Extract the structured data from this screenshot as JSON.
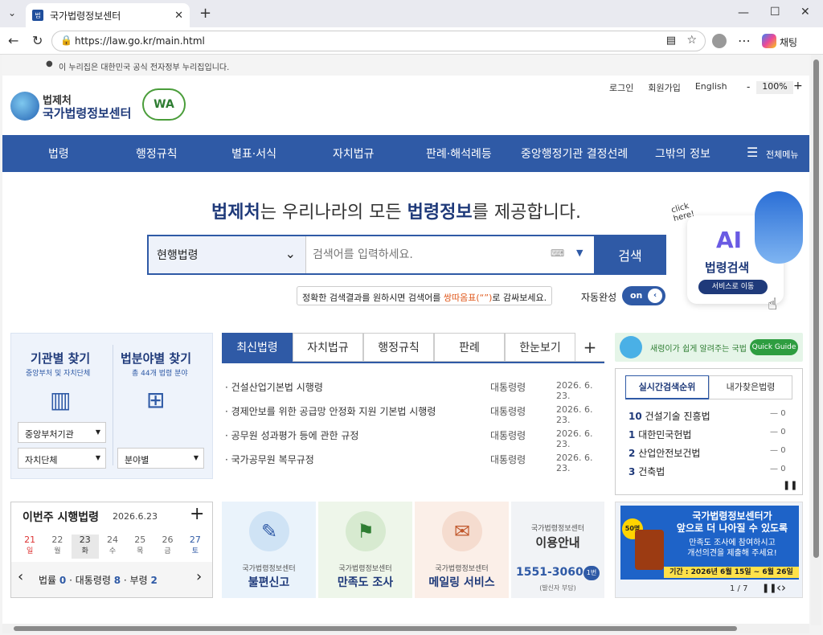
{
  "browser": {
    "tab_title": "국가법령정보센터",
    "url": "https://law.go.kr/main.html",
    "copilot": "채팅",
    "favicon_text": "법"
  },
  "gov_notice": "이 누리집은 대한민국 공식 전자정부 누리집입니다.",
  "header": {
    "org": "법제처",
    "site": "국가법령정보센터",
    "wa": "WA",
    "links": [
      "로그인",
      "회원가입",
      "English"
    ],
    "zoom": "100%",
    "zoom_minus": "-",
    "zoom_plus": "+"
  },
  "gnb": {
    "items": [
      "법령",
      "행정규칙",
      "별표·서식",
      "자치법규",
      "판례·해석례등",
      "중앙행정기관 결정선례",
      "그밖의 정보"
    ],
    "all_menu": "전체메뉴"
  },
  "search": {
    "headline_a": "법제처",
    "headline_b": "는 우리나라의 모든 ",
    "headline_c": "법령정보",
    "headline_d": "를 제공합니다.",
    "scope": "현행법령",
    "placeholder": "검색어를 입력하세요.",
    "button": "검색",
    "tip_a": "정확한 검색결과를 원하시면 검색어를 ",
    "tip_b": "쌍따옴표(“”)",
    "tip_c": "로 감싸보세요.",
    "autocomplete_label": "자동완성",
    "autocomplete_state": "on"
  },
  "ai": {
    "click": "click here!",
    "title_a": "AI",
    "title_b": "법령검색",
    "btn": "서비스로 이동"
  },
  "left_box": {
    "org_title": "기관별 찾기",
    "org_sub": "중앙부처 및 자치단체",
    "field_title": "법분야별 찾기",
    "field_sub": "총 44개 법령 분야",
    "sel1": "중앙부처기관",
    "sel2": "자치단체",
    "sel3": "분야별"
  },
  "news": {
    "tabs": [
      "최신법령",
      "자치법규",
      "행정규칙",
      "판례",
      "한눈보기",
      "+"
    ],
    "rows": [
      {
        "t": "건설산업기본법 시행령",
        "k": "대통령령",
        "d": "2026. 6. 23."
      },
      {
        "t": "경제안보를 위한 공급망 안정화 지원 기본법 시행령",
        "k": "대통령령",
        "d": "2026. 6. 23."
      },
      {
        "t": "공무원 성과평가 등에 관한 규정",
        "k": "대통령령",
        "d": "2026. 6. 23."
      },
      {
        "t": "국가공무원 복무규정",
        "k": "대통령령",
        "d": "2026. 6. 23."
      }
    ]
  },
  "banner_guide": {
    "text": "새령이가 쉽게 알려주는 국법",
    "btn": "Quick Guide"
  },
  "ranking": {
    "tabs": [
      "실시간검색순위",
      "내가찾은법령"
    ],
    "items": [
      {
        "n": "10",
        "t": "건설기술 진흥법",
        "c": "0"
      },
      {
        "n": "1",
        "t": "대한민국헌법",
        "c": "0"
      },
      {
        "n": "2",
        "t": "산업안전보건법",
        "c": "0"
      },
      {
        "n": "3",
        "t": "건축법",
        "c": "0"
      }
    ],
    "pause": "❚❚"
  },
  "week": {
    "title": "이번주 시행법령",
    "date": "2026.6.23",
    "plus": "+",
    "days": [
      {
        "n": "21",
        "w": "일"
      },
      {
        "n": "22",
        "w": "월"
      },
      {
        "n": "23",
        "w": "화"
      },
      {
        "n": "24",
        "w": "수"
      },
      {
        "n": "25",
        "w": "목"
      },
      {
        "n": "26",
        "w": "금"
      },
      {
        "n": "27",
        "w": "토"
      }
    ],
    "law_label": "법률",
    "law_n": "0",
    "pres_label": "대통령령",
    "pres_n": "8",
    "min_label": "부령",
    "min_n": "2"
  },
  "services": [
    {
      "sub": "국가법령정보센터",
      "title": "불편신고"
    },
    {
      "sub": "국가법령정보센터",
      "title": "만족도 조사"
    },
    {
      "sub": "국가법령정보센터",
      "title": "메일링 서비스"
    }
  ],
  "info": {
    "sub": "국가법령정보센터",
    "title": "이용안내",
    "phone": "1551-3060",
    "ext": "1번",
    "note": "(발신자 부담)"
  },
  "promo": {
    "badge": "50명",
    "l1": "국가법령정보센터가",
    "l2": "앞으로 더 나아질 수 있도록",
    "l3": "만족도 조사에 참여하시고",
    "l4": "개선의견을 제출해 주세요!",
    "period": "기간 : 2026년 6월 15일 ~ 6월 26일",
    "page": "1 / 7"
  }
}
